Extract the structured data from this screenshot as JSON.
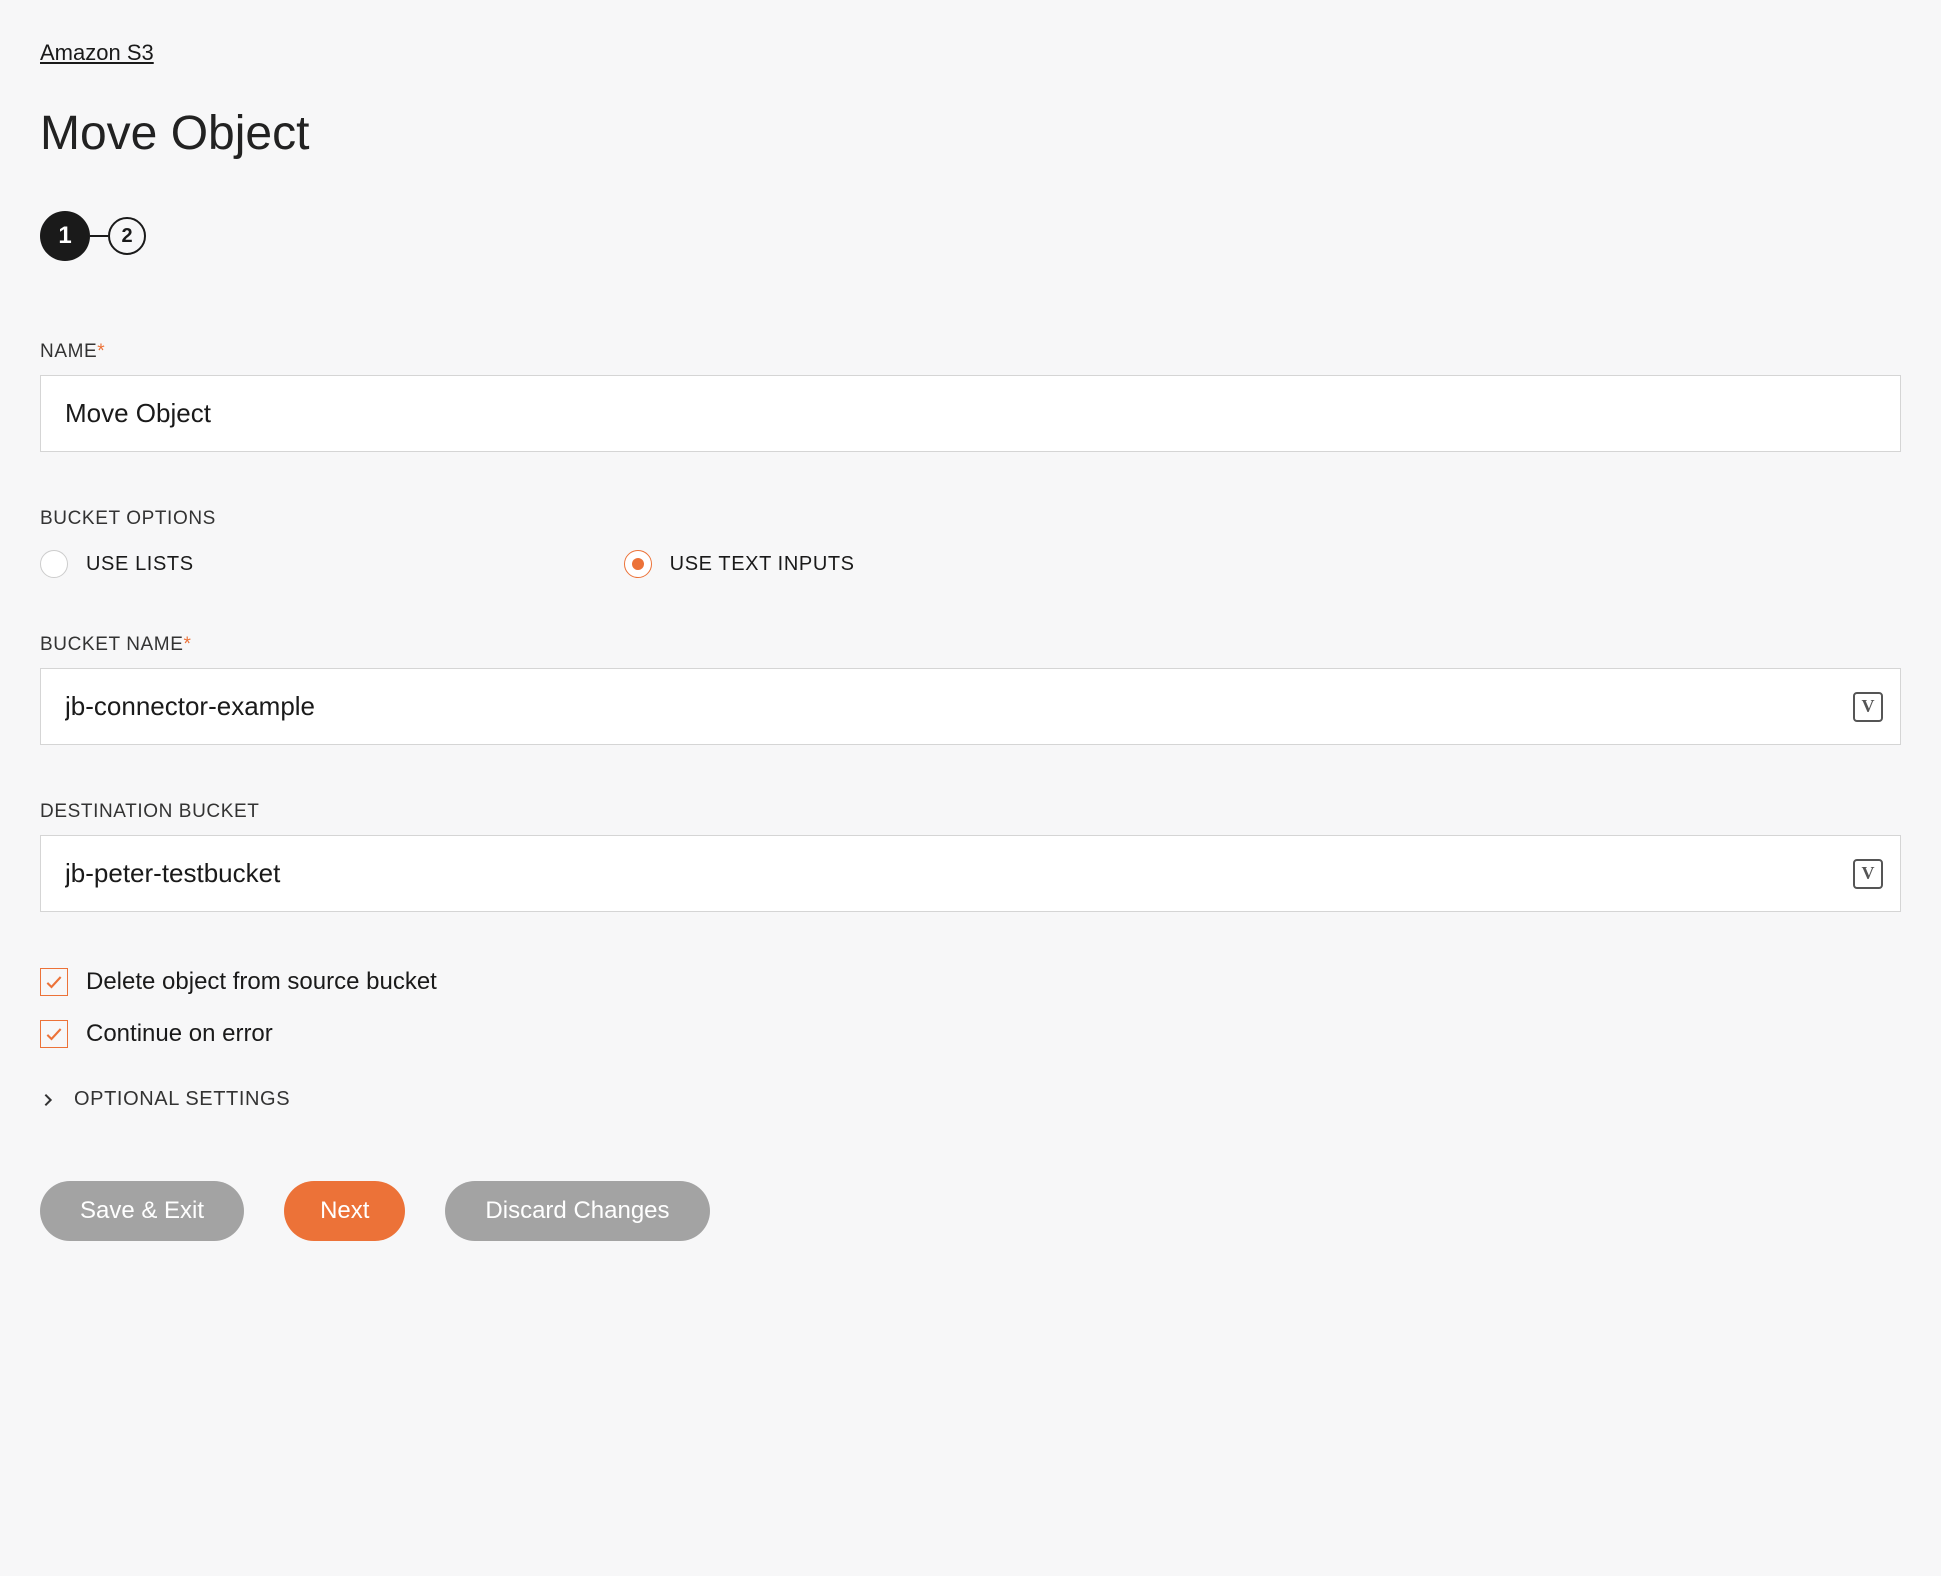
{
  "breadcrumb": "Amazon S3",
  "title": "Move Object",
  "stepper": {
    "steps": [
      "1",
      "2"
    ],
    "active_index": 0
  },
  "name": {
    "label": "NAME",
    "required": true,
    "value": "Move Object"
  },
  "bucket_options": {
    "label": "BUCKET OPTIONS",
    "use_lists": "USE LISTS",
    "use_text_inputs": "USE TEXT INPUTS",
    "selected": "use_text_inputs"
  },
  "bucket_name": {
    "label": "BUCKET NAME",
    "required": true,
    "value": "jb-connector-example"
  },
  "destination_bucket": {
    "label": "DESTINATION BUCKET",
    "required": false,
    "value": "jb-peter-testbucket"
  },
  "delete_source": {
    "label": "Delete object from source bucket",
    "checked": true
  },
  "continue_on_error": {
    "label": "Continue on error",
    "checked": true
  },
  "optional_settings": "OPTIONAL SETTINGS",
  "buttons": {
    "save_exit": "Save & Exit",
    "next": "Next",
    "discard": "Discard Changes"
  }
}
